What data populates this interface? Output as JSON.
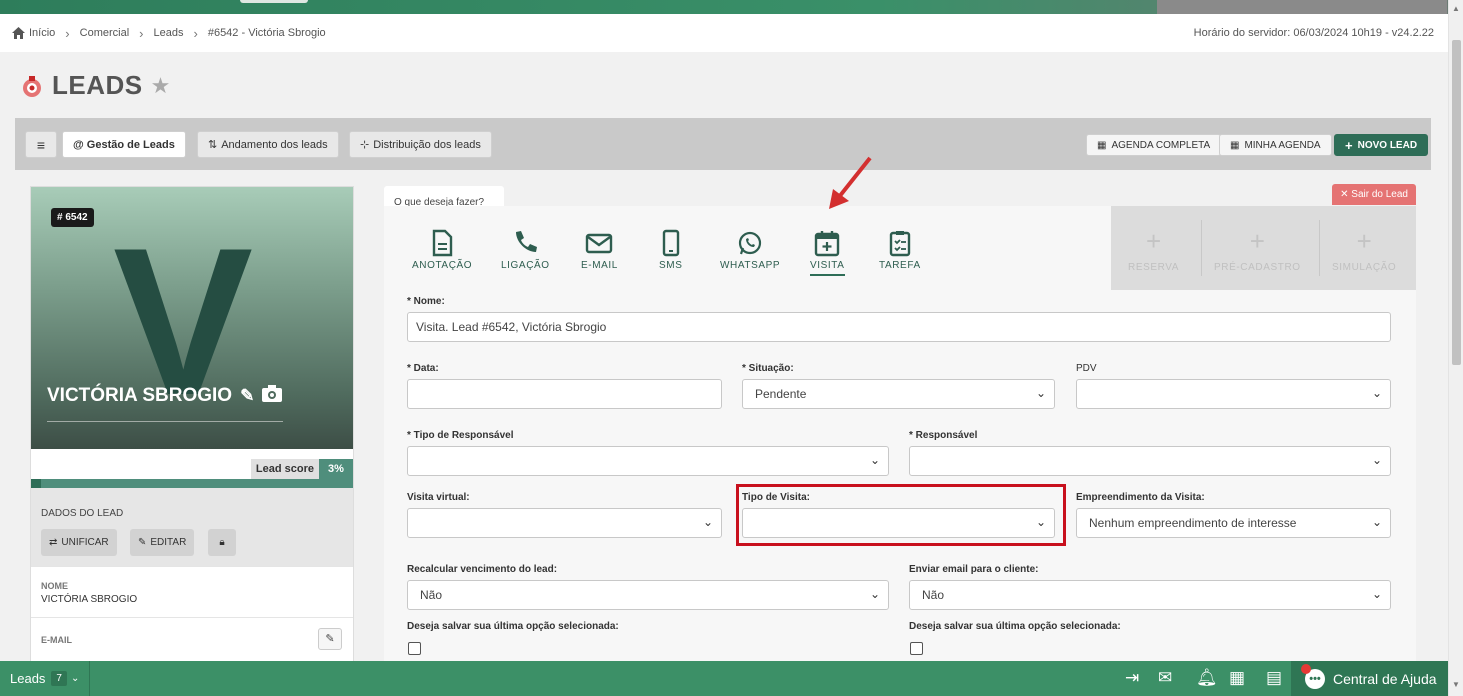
{
  "breadcrumb": {
    "home": "Início",
    "items": [
      "Comercial",
      "Leads",
      "#6542 - Victória Sbrogio"
    ],
    "server_time": "Horário do servidor: 06/03/2024 10h19 - v24.2.22"
  },
  "page": {
    "title": "LEADS"
  },
  "toolbar": {
    "menu_icon": "≡",
    "tabs": [
      "@ Gestão de Leads",
      "Andamento dos leads",
      "Distribuição dos leads"
    ],
    "agenda_completa": "AGENDA COMPLETA",
    "minha_agenda": "MINHA AGENDA",
    "novo_lead": "NOVO LEAD"
  },
  "lead": {
    "id_badge": "# 6542",
    "initial": "V",
    "name": "VICTÓRIA SBROGIO",
    "score_label": "Lead score",
    "score_value": "3%",
    "score_fraction": 0.03,
    "section_title": "DADOS DO LEAD",
    "btn_unificar": "UNIFICAR",
    "btn_editar": "EDITAR",
    "field_nome_label": "NOME",
    "field_nome_value": "VICTÓRIA SBROGIO",
    "field_email_label": "E-MAIL"
  },
  "actions": {
    "prompt": "O que deseja fazer?",
    "exit": "Sair do Lead",
    "items": [
      "ANOTAÇÃO",
      "LIGAÇÃO",
      "E-MAIL",
      "SMS",
      "WHATSAPP",
      "VISITA",
      "TAREFA"
    ],
    "disabled": [
      "RESERVA",
      "PRÉ-CADASTRO",
      "SIMULAÇÃO"
    ]
  },
  "form": {
    "nome_label": "* Nome:",
    "nome_value": "Visita. Lead #6542, Victória Sbrogio",
    "data_label": "* Data:",
    "situacao_label": "* Situação:",
    "situacao_value": "Pendente",
    "pdv_label": "PDV",
    "tipo_resp_label": "* Tipo de Responsável",
    "responsavel_label": "* Responsável",
    "visita_virtual_label": "Visita virtual:",
    "tipo_visita_label": "Tipo de Visita:",
    "empreendimento_label": "Empreendimento da Visita:",
    "empreendimento_value": "Nenhum empreendimento de interesse",
    "recalcular_label": "Recalcular vencimento do lead:",
    "recalcular_value": "Não",
    "enviar_email_label": "Enviar email para o cliente:",
    "enviar_email_value": "Não",
    "salvar_label_1": "Deseja salvar sua última opção selecionada:",
    "salvar_label_2": "Deseja salvar sua última opção selecionada:"
  },
  "bottombar": {
    "leads_label": "Leads",
    "leads_count": "7",
    "help": "Central de Ajuda"
  },
  "colors": {
    "brand": "#2e6d57",
    "bottombar": "#3c9067",
    "highlight": "#c8101e"
  }
}
